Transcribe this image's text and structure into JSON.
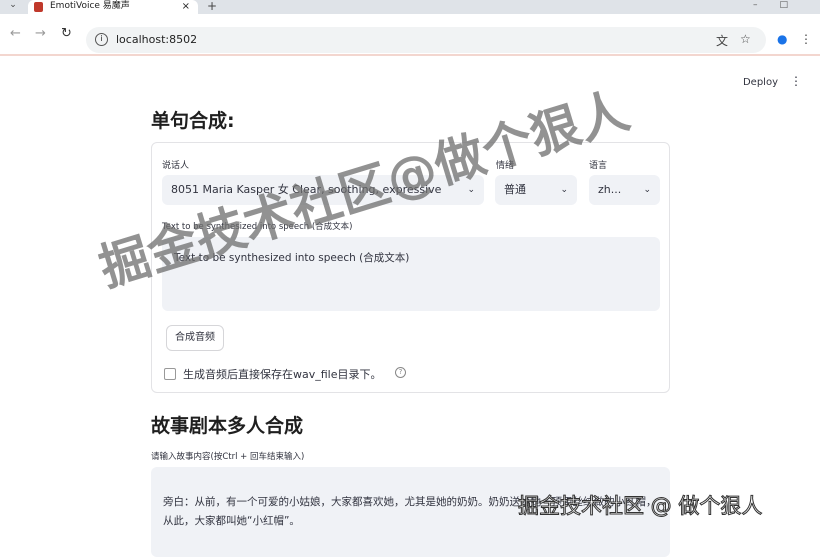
{
  "browser": {
    "tab_title": "EmotiVoice 易魔声",
    "url": "localhost:8502",
    "new_tab": "+",
    "close": "×"
  },
  "header": {
    "deploy_label": "Deploy",
    "menu_icon": "⋮"
  },
  "single": {
    "title": "单句合成:",
    "speaker_label": "说话人",
    "speaker_value": "8051 Maria Kasper 女 Clear, soothing, expressive",
    "emotion_label": "情绪",
    "emotion_value": "普通",
    "language_label": "语言",
    "language_value": "zh...",
    "text_label": "Text to be synthesized into speech (合成文本)",
    "text_value": "Text to be synthesized into speech (合成文本)",
    "synth_button": "合成音频",
    "save_checkbox_label": "生成音频后直接保存在wav_file目录下。",
    "save_checked": false
  },
  "story": {
    "title": "故事剧本多人合成",
    "input_label": "请输入故事内容(按Ctrl + 回车结束输入)",
    "input_value": "旁白：从前，有一个可爱的小姑娘，大家都喜欢她，尤其是她的奶奶。奶奶送给她一顶用丝绒做的小红帽，从此，大家都叫她“小红帽”。"
  },
  "watermarks": [
    "掘金技术社区@做个狠人",
    "掘金技术社区 @ 做个狠人"
  ]
}
